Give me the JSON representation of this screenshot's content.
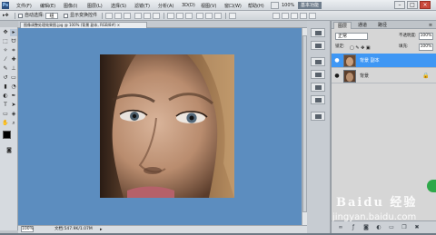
{
  "menubar": {
    "logo": "Ps",
    "items": [
      "文件(F)",
      "编辑(E)",
      "图像(I)",
      "图层(L)",
      "选择(S)",
      "滤镜(T)",
      "分析(A)",
      "3D(D)",
      "视图(V)",
      "窗口(W)",
      "帮助(H)"
    ],
    "zoom": "100%",
    "workspace": "基本功能",
    "window_min": "–",
    "window_max": "□",
    "window_close": "×"
  },
  "options": {
    "auto_select_label": "自动选择:",
    "auto_select_value": "组",
    "show_transform_label": "显示变换控件"
  },
  "document": {
    "tab_title": "图像调整处理效果图.jpg @ 100% (背景 副本, RGB/8#) ×"
  },
  "status": {
    "zoom": "100%",
    "doc_info": "文档:547.9K/1.07M"
  },
  "layers_panel": {
    "tabs": [
      "图层",
      "通道",
      "路径"
    ],
    "blend_mode": "正常",
    "opacity_label": "不透明度:",
    "opacity_value": "100%",
    "lock_label": "锁定:",
    "fill_label": "填充:",
    "fill_value": "100%",
    "layers": [
      {
        "name": "背景 副本",
        "selected": true,
        "eye": "●"
      },
      {
        "name": "背景",
        "selected": false,
        "eye": "●",
        "lock": "🔒"
      }
    ],
    "bottom_icons": [
      "link-icon",
      "fx-icon",
      "mask-icon",
      "adjustment-icon",
      "group-icon",
      "new-layer-icon",
      "trash-icon"
    ]
  },
  "watermark": {
    "brand": "Baidu 经验",
    "url": "jingyan.baidu.com"
  },
  "colors": {
    "canvas_bg": "#5c8dbf",
    "selected_layer": "#3f97f4"
  }
}
